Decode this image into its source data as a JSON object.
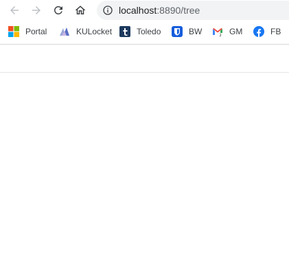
{
  "browser": {
    "url_host": "localhost",
    "url_rest": ":8890/tree",
    "colors": {
      "omnibox_bg": "#f1f3f4",
      "icon_gray": "#5f6368",
      "disabled_gray": "#bdc1c6"
    }
  },
  "bookmarks": [
    {
      "label": "Portal",
      "icon": "windows-logo-icon"
    },
    {
      "label": "KULocket",
      "icon": "kulocket-icon"
    },
    {
      "label": "Toledo",
      "icon": "toledo-t-icon"
    },
    {
      "label": "BW",
      "icon": "bitwarden-shield-icon"
    },
    {
      "label": "GM",
      "icon": "gmail-icon"
    },
    {
      "label": "FB",
      "icon": "facebook-icon"
    }
  ]
}
